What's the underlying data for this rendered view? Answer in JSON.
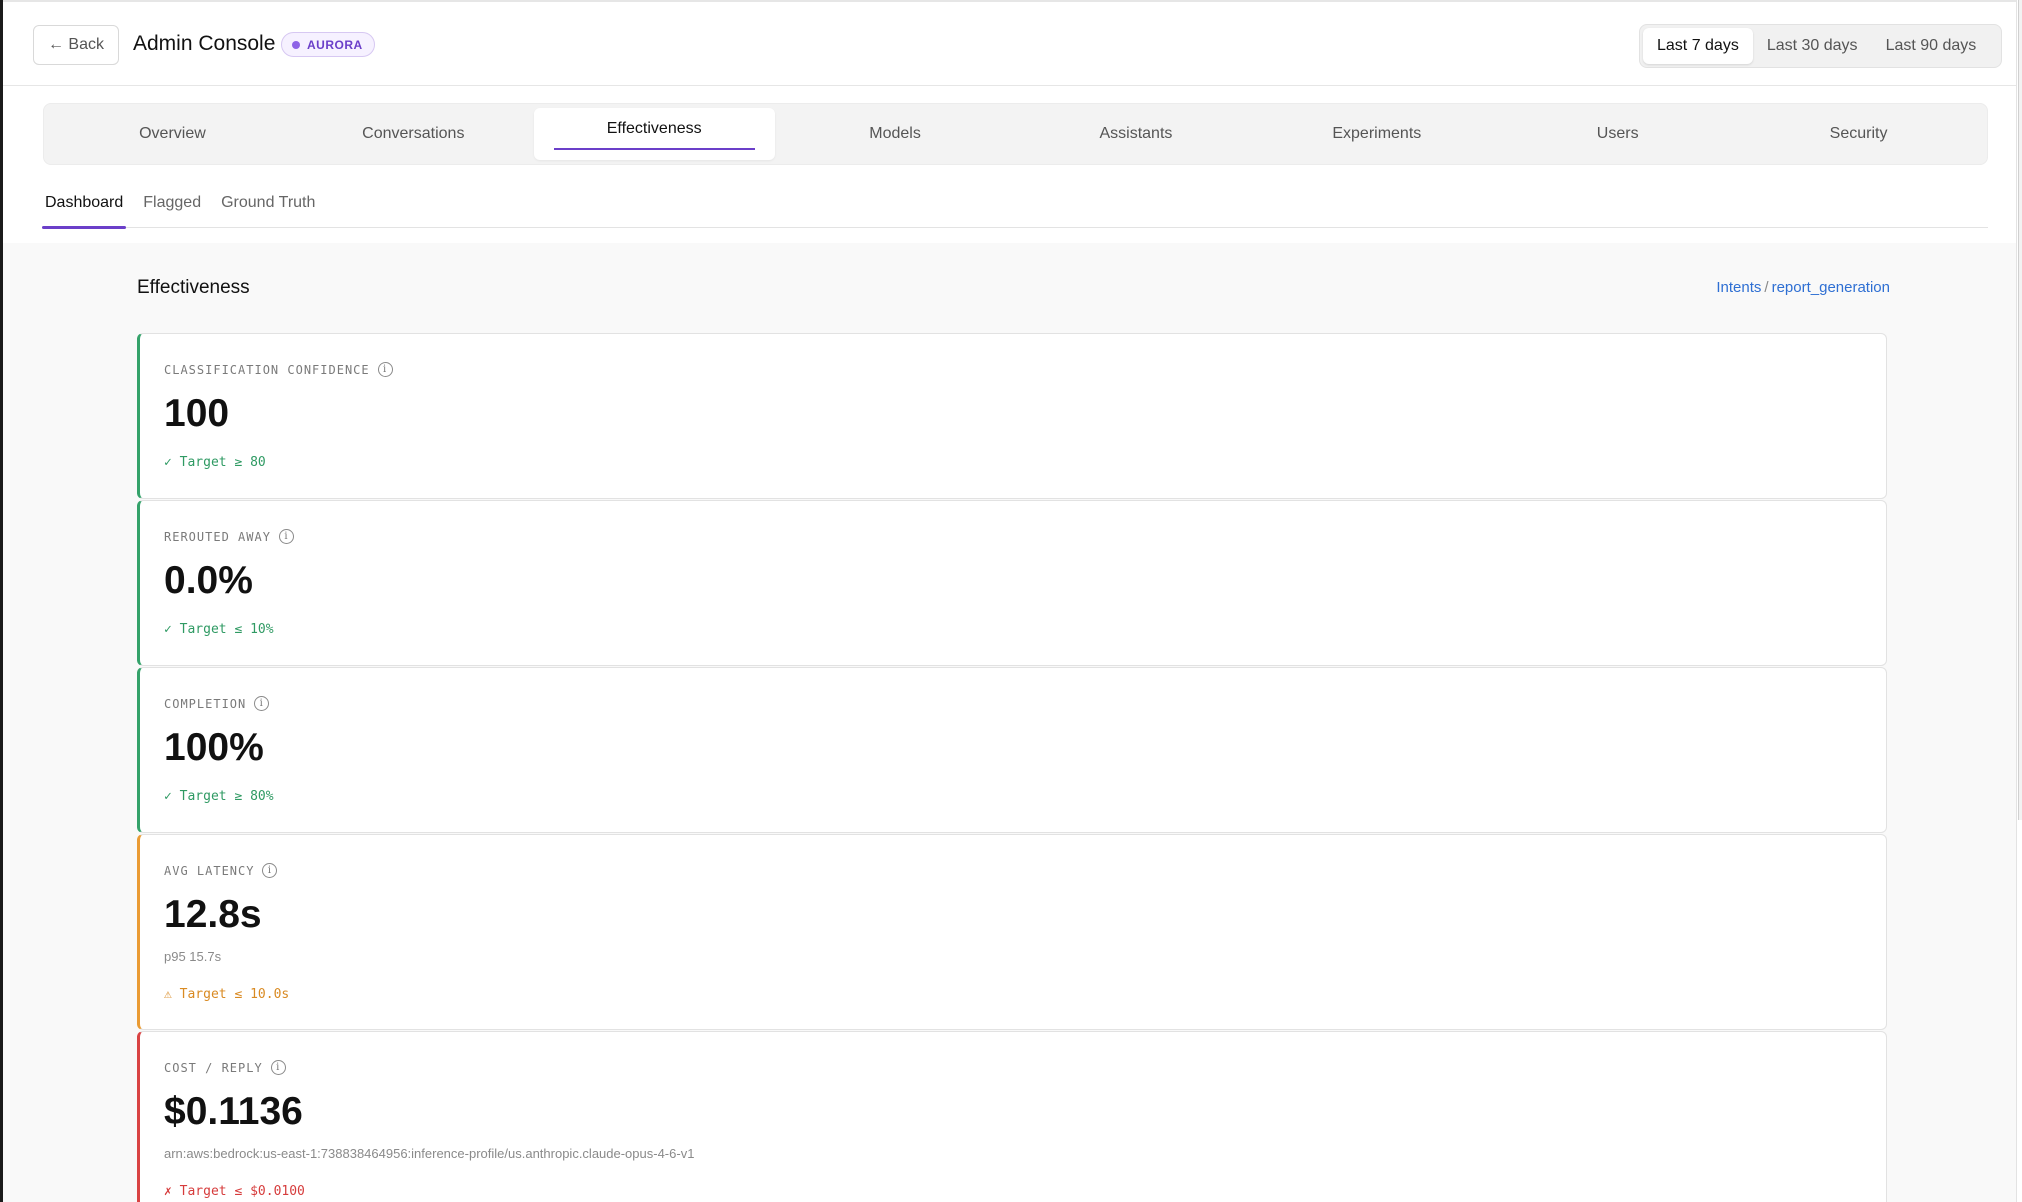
{
  "header": {
    "back_label": "← Back",
    "title": "Admin Console",
    "env_badge": "AURORA",
    "ranges": [
      "Last 7 days",
      "Last 30 days",
      "Last 90 days"
    ],
    "active_range": "Last 7 days"
  },
  "main_nav": {
    "tabs": [
      "Overview",
      "Conversations",
      "Effectiveness",
      "Models",
      "Assistants",
      "Experiments",
      "Users",
      "Security"
    ],
    "active": "Effectiveness"
  },
  "sub_nav": {
    "tabs": [
      "Dashboard",
      "Flagged",
      "Ground Truth"
    ],
    "active": "Dashboard"
  },
  "section": {
    "title": "Effectiveness",
    "breadcrumb_root": "Intents",
    "breadcrumb_sep": "/",
    "breadcrumb_leaf": "report_generation"
  },
  "metrics": [
    {
      "label": "CLASSIFICATION CONFIDENCE",
      "value": "100",
      "sub": "",
      "target_icon": "✓",
      "target": "Target ≥ 80",
      "status": "ok"
    },
    {
      "label": "REROUTED AWAY",
      "value": "0.0%",
      "sub": "",
      "target_icon": "✓",
      "target": "Target ≤ 10%",
      "status": "ok"
    },
    {
      "label": "COMPLETION",
      "value": "100%",
      "sub": "",
      "target_icon": "✓",
      "target": "Target ≥ 80%",
      "status": "ok"
    },
    {
      "label": "AVG LATENCY",
      "value": "12.8s",
      "sub": "p95 15.7s",
      "target_icon": "⚠",
      "target": "Target ≤ 10.0s",
      "status": "warn"
    },
    {
      "label": "COST / REPLY",
      "value": "$0.1136",
      "sub": "arn:aws:bedrock:us-east-1:738838464956:inference-profile/us.anthropic.claude-opus-4-6-v1",
      "target_icon": "✗",
      "target": "Target ≤ $0.0100",
      "status": "bad"
    }
  ],
  "colors": {
    "accent": "#6b3fc9",
    "ok": "#34a26a",
    "warn": "#ea9b34",
    "bad": "#d94343",
    "link": "#2e6fd3"
  },
  "icons": {
    "info": "info-icon"
  }
}
